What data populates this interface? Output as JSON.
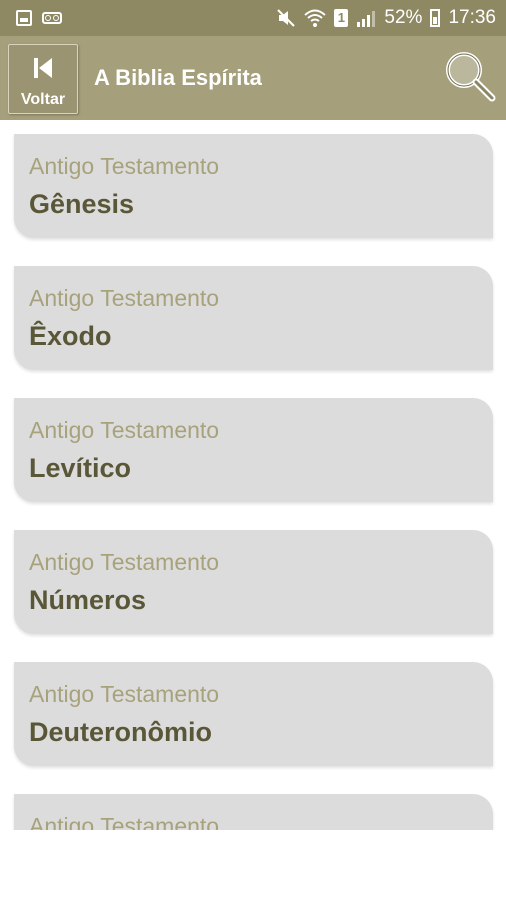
{
  "status_bar": {
    "battery": "52%",
    "time": "17:36",
    "sim_slot": "1",
    "icons": [
      "image-icon",
      "voicemail-icon",
      "mute-icon",
      "wifi-icon",
      "sim-icon",
      "signal-icon",
      "battery-icon"
    ]
  },
  "app_bar": {
    "back_label": "Voltar",
    "title": "A Biblia Espírita",
    "search_icon": "magnifier-icon"
  },
  "books": [
    {
      "testament": "Antigo Testamento",
      "name": "Gênesis"
    },
    {
      "testament": "Antigo Testamento",
      "name": "Êxodo"
    },
    {
      "testament": "Antigo Testamento",
      "name": "Levítico"
    },
    {
      "testament": "Antigo Testamento",
      "name": "Números"
    },
    {
      "testament": "Antigo Testamento",
      "name": "Deuteronômio"
    },
    {
      "testament": "Antigo Testamento",
      "name": ""
    }
  ],
  "colors": {
    "status_bar": "#8e8863",
    "app_bar": "#a59f7b",
    "card": "#dcdcdc",
    "testament_text": "#a8a27c",
    "book_text": "#5a5638"
  }
}
